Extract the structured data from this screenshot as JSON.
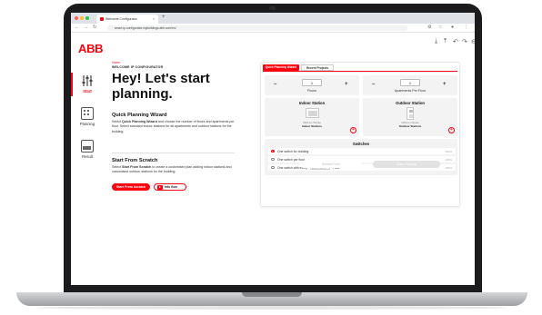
{
  "browser": {
    "tab_title": "Welcome Configurator",
    "new_tab": "+",
    "tab_close": "×",
    "url": "smart-ip-configurator.mybuildings.abb.com/en/",
    "nav": {
      "back": "←",
      "forward": "→",
      "reload": "↻"
    }
  },
  "app": {
    "logo": "ABB",
    "header_icons": [
      "⤓",
      "⤒",
      "↶",
      "↷",
      "⊖"
    ]
  },
  "sidebar": {
    "items": [
      {
        "label": "Start",
        "icon": "sliders-icon",
        "active": true
      },
      {
        "label": "Planning",
        "icon": "planning-icon",
        "active": false
      },
      {
        "label": "Result",
        "icon": "result-icon",
        "active": false
      }
    ]
  },
  "intro": {
    "home_link": "Home",
    "welcome": "WELCOME IP CONFIGURATOR",
    "headline": "Hey! Let's start planning."
  },
  "quick_wizard": {
    "title": "Quick Planning Wizard",
    "desc_prefix": "Select ",
    "desc_bold": "Quick Planning Wizard",
    "desc_suffix": " and choose the number of floors and apartments per floor. Select standard indoor stations for all apartments and outdoor stations for the building."
  },
  "scratch": {
    "title": "Start From Scratch",
    "desc_prefix": "Select ",
    "desc_bold": "Start From Scratch",
    "desc_suffix": " to create a customised plan adding indoor stations and customised outdoor stations for the building.",
    "start_button": "Start From Scratch",
    "info_button": "Info flow"
  },
  "panel": {
    "tab_active": "Quick Planning Wizard",
    "tab_inactive": "Recent Projects",
    "floors": {
      "value": "1",
      "label": "Floors",
      "minus": "–",
      "plus": "+"
    },
    "apartments": {
      "value": "1",
      "label": "Apartments Per Floor",
      "minus": "–",
      "plus": "+"
    },
    "indoor": {
      "title": "Indoor Station",
      "caption": "Click to choose",
      "name": "Indoor Stations",
      "add": "+"
    },
    "outdoor": {
      "title": "Outdoor Station",
      "caption": "Click to choose",
      "name": "Outdoor Stations",
      "add": "+"
    },
    "switches": {
      "title": "Switches",
      "options": [
        {
          "label": "One switch for building",
          "value": "100%",
          "selected": true
        },
        {
          "label": "One switch per floor",
          "value": "100%",
          "selected": false
        },
        {
          "label": "One switch with every",
          "input_placeholder": "Enter Floors",
          "suffix": "Floor",
          "value": "100%",
          "selected": false
        }
      ]
    },
    "footer": {
      "secondary": "Refresh Form",
      "primary": "Finish Planning"
    }
  },
  "colors": {
    "brand": "#ff000f",
    "panel_bg": "#f3f3f3"
  }
}
